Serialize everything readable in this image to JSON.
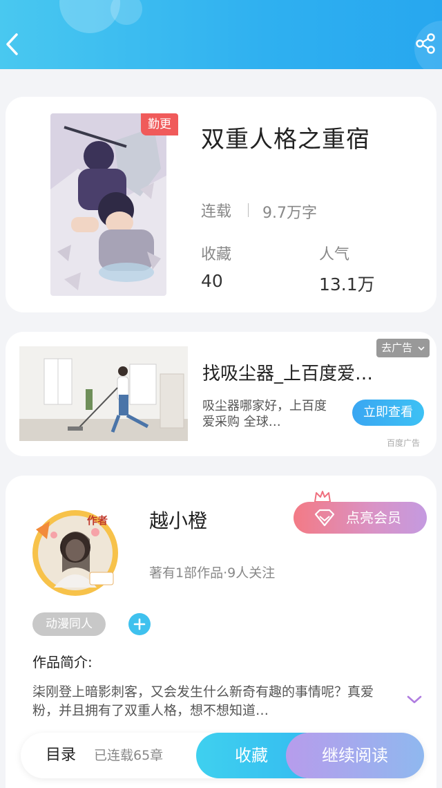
{
  "header": {
    "back_icon": "chevron-left-icon",
    "share_icon": "share-icon"
  },
  "book": {
    "badge": "勤更",
    "title": "双重人格之重宿",
    "status": "连载",
    "word_count": "9.7万字",
    "stats": [
      {
        "label": "收藏",
        "value": "40"
      },
      {
        "label": "人气",
        "value": "13.1万"
      }
    ]
  },
  "ad": {
    "close_label": "去广告",
    "title": "找吸尘器_上百度爱…",
    "description": "吸尘器哪家好，上百度爱采购 全球…",
    "cta_label": "立即查看",
    "source": "百度广告"
  },
  "author": {
    "avatar_badge": "作者",
    "name": "越小橙",
    "meta": "著有1部作品·9人关注",
    "vip_label": "点亮会员",
    "tag": "动漫同人",
    "intro_heading": "作品简介:",
    "intro_text": "柒刚登上暗影刺客，又会发生什么新奇有趣的事情呢？真爱粉，并且拥有了双重人格，想不想知道…"
  },
  "bottom_bar": {
    "toc_label": "目录",
    "chapter_count": "已连载65章",
    "collect_label": "收藏",
    "read_label": "继续阅读"
  },
  "colors": {
    "header_accent": "#2fb0f0",
    "update_badge": "#f05a5a",
    "cta_blue": "#3aa6f2",
    "tag_plus": "#3fc1ee"
  }
}
